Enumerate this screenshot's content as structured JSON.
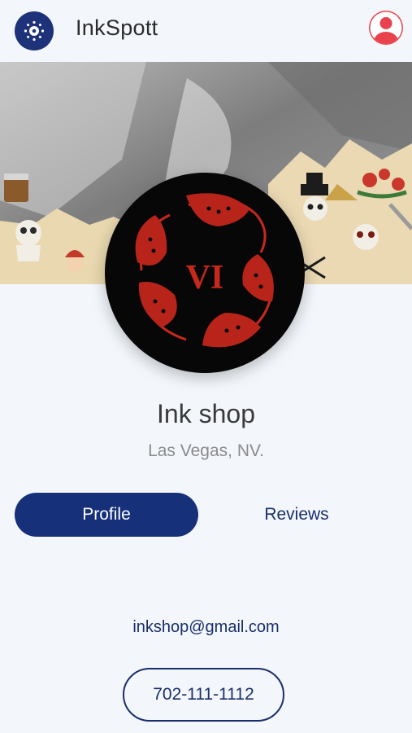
{
  "app": {
    "title": "InkSpott",
    "logo_icon": "paw-badge-icon",
    "account_icon": "user-circle-icon",
    "accent_color": "#16307a",
    "account_color": "#e8434c"
  },
  "shop": {
    "name": "Ink shop",
    "location": "Las Vegas, NV.",
    "logo_text": "VI",
    "logo_motif": "koi-fish-circle"
  },
  "tabs": {
    "profile_label": "Profile",
    "reviews_label": "Reviews",
    "active": "Profile"
  },
  "contact": {
    "email": "inkshop@gmail.com",
    "phone": "702-111-1112"
  }
}
